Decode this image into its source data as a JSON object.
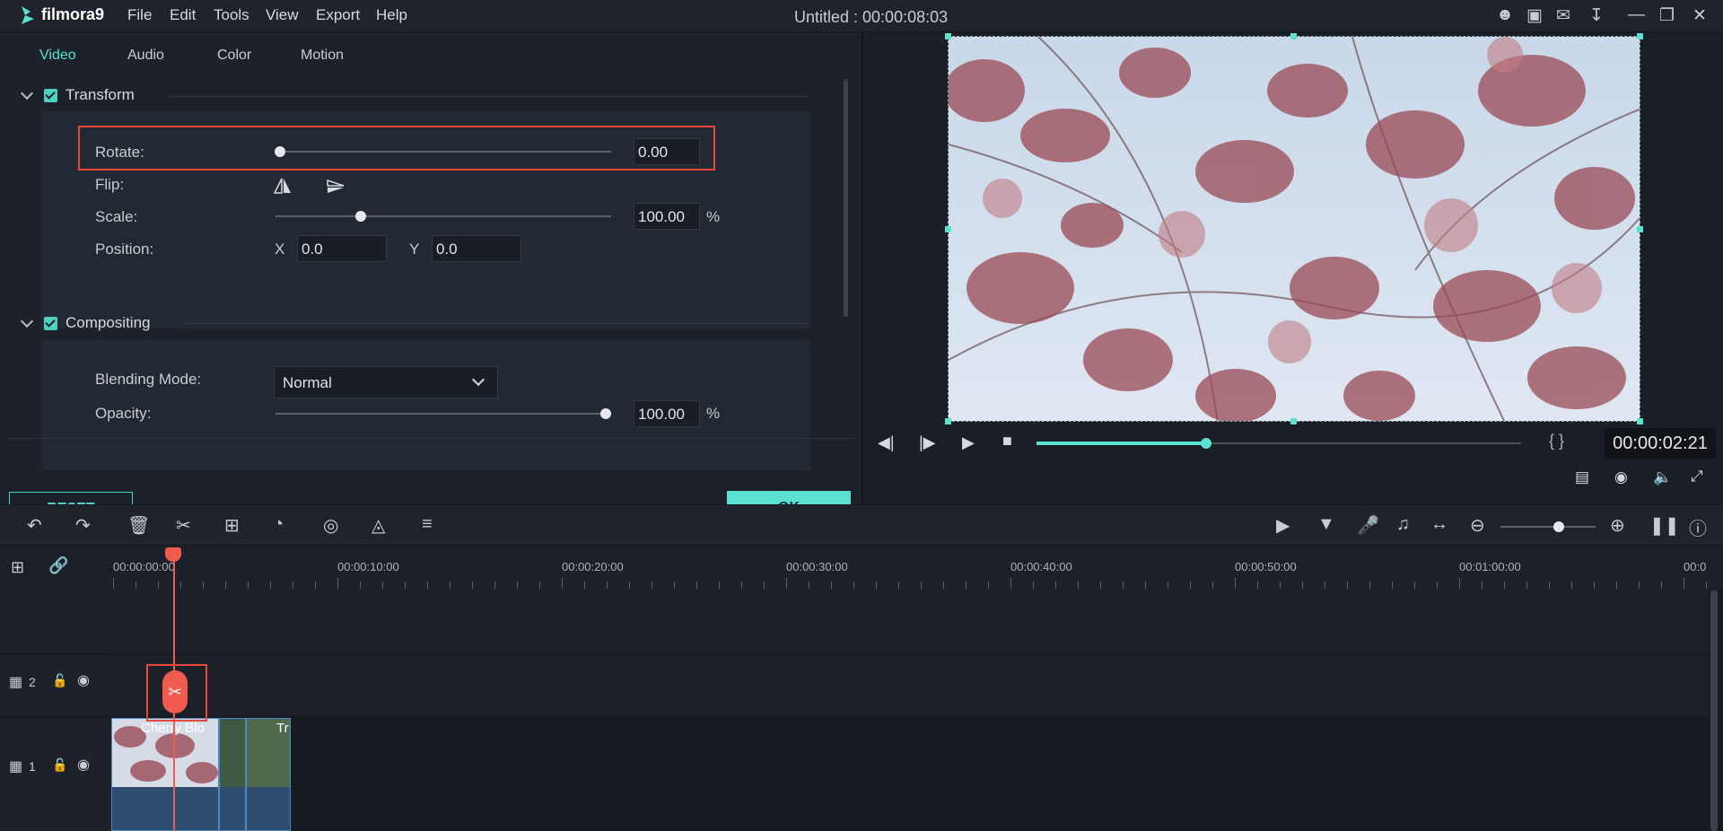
{
  "app": {
    "logo": "filmora9",
    "title": "Untitled : 00:00:08:03"
  },
  "menu": [
    "File",
    "Edit",
    "Tools",
    "View",
    "Export",
    "Help"
  ],
  "window_icons": [
    "user-icon",
    "save-icon",
    "mail-icon",
    "download-icon",
    "minimize-icon",
    "restore-icon",
    "close-icon"
  ],
  "tabs": [
    "Video",
    "Audio",
    "Color",
    "Motion"
  ],
  "transform": {
    "title": "Transform",
    "rotate": {
      "label": "Rotate:",
      "value": "0.00",
      "level": 0.0
    },
    "flip": {
      "label": "Flip:"
    },
    "scale": {
      "label": "Scale:",
      "value": "100.00",
      "unit": "%",
      "level": 0.25
    },
    "position": {
      "label": "Position:",
      "x_label": "X",
      "x": "0.0",
      "y_label": "Y",
      "y": "0.0"
    }
  },
  "compositing": {
    "title": "Compositing",
    "blend": {
      "label": "Blending Mode:",
      "value": "Normal"
    },
    "opacity": {
      "label": "Opacity:",
      "value": "100.00",
      "unit": "%",
      "level": 1.0
    }
  },
  "buttons": {
    "reset": "RESET",
    "ok": "OK"
  },
  "player": {
    "timecode": "00:00:02:21",
    "progress": 0.35,
    "mark": "{ }"
  },
  "ruler": {
    "labels": [
      "00:00:00:00",
      "00:00:10:00",
      "00:00:20:00",
      "00:00:30:00",
      "00:00:40:00",
      "00:00:50:00",
      "00:01:00:00",
      "00:0"
    ]
  },
  "tracks": [
    {
      "number": "2"
    },
    {
      "number": "1"
    }
  ],
  "clips": {
    "clip1": "Cherry Blo",
    "clip2": "Tr"
  },
  "colors": {
    "accent": "#5ce0d0",
    "highlight": "#e8473b",
    "playhead": "#f05a4f"
  }
}
